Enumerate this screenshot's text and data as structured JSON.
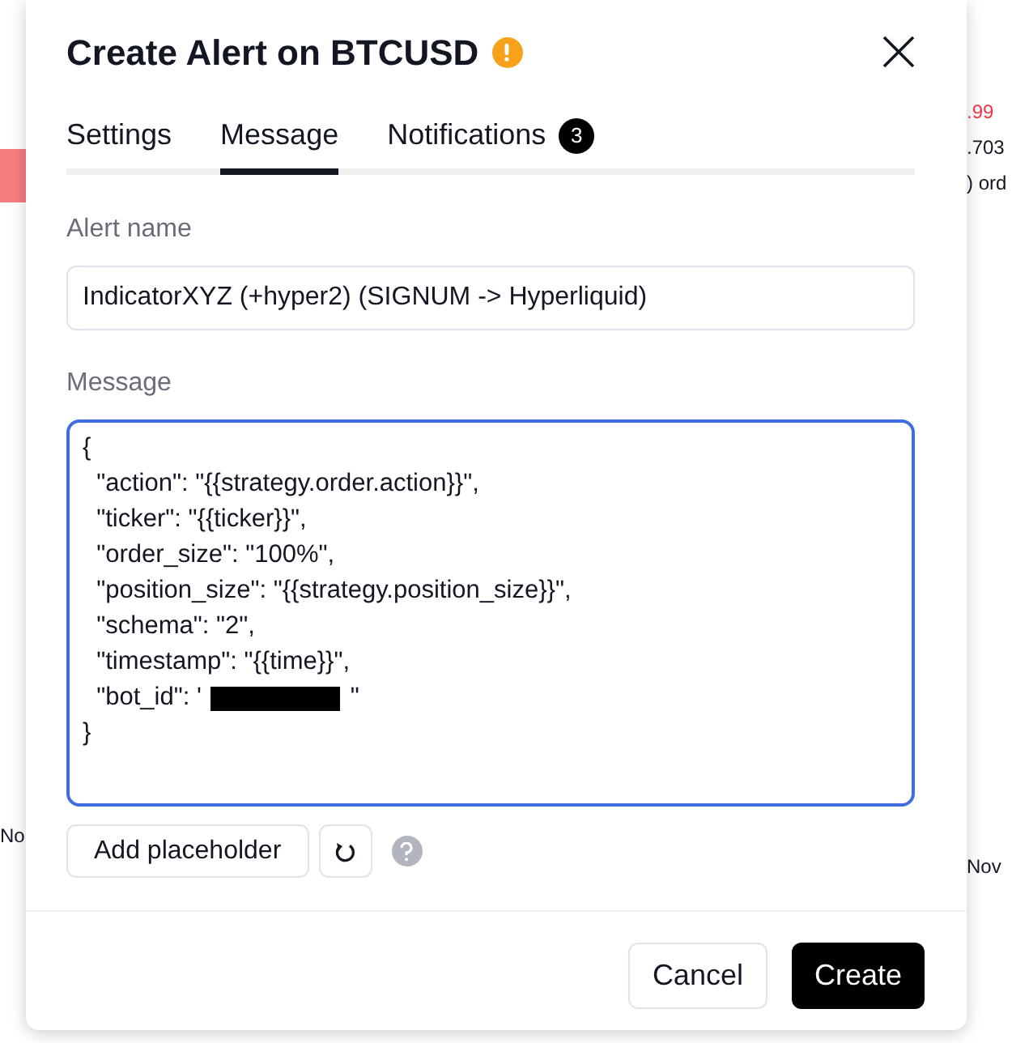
{
  "background": {
    "left_labels": [
      "No"
    ],
    "right_labels": [
      ".99",
      ".703",
      ") ord",
      "Nov"
    ]
  },
  "dialog": {
    "title": "Create Alert on BTCUSD",
    "warning": true,
    "tabs": [
      {
        "label": "Settings",
        "selected": false
      },
      {
        "label": "Message",
        "selected": true
      },
      {
        "label": "Notifications",
        "selected": false,
        "badge": "3"
      }
    ],
    "alert_name": {
      "label": "Alert name",
      "value": "IndicatorXYZ (+hyper2) (SIGNUM -> Hyperliquid)"
    },
    "message": {
      "label": "Message",
      "focused": true,
      "lines": [
        {
          "text": "{"
        },
        {
          "text": "  \"action\": \"{{strategy.order.action}}\","
        },
        {
          "text": "  \"ticker\": \"{{ticker}}\","
        },
        {
          "text": "  \"order_size\": \"100%\","
        },
        {
          "text": "  \"position_size\": \"{{strategy.position_size}}\","
        },
        {
          "text": "  \"schema\": \"2\","
        },
        {
          "text": "  \"timestamp\": \"{{time}}\","
        },
        {
          "text": "  \"bot_id\": '",
          "redacted": true,
          "after": "\""
        },
        {
          "text": "}"
        }
      ]
    },
    "add_placeholder": "Add placeholder",
    "buttons": [
      {
        "label": "Cancel",
        "kind": "secondary"
      },
      {
        "label": "Create",
        "kind": "primary"
      }
    ]
  }
}
